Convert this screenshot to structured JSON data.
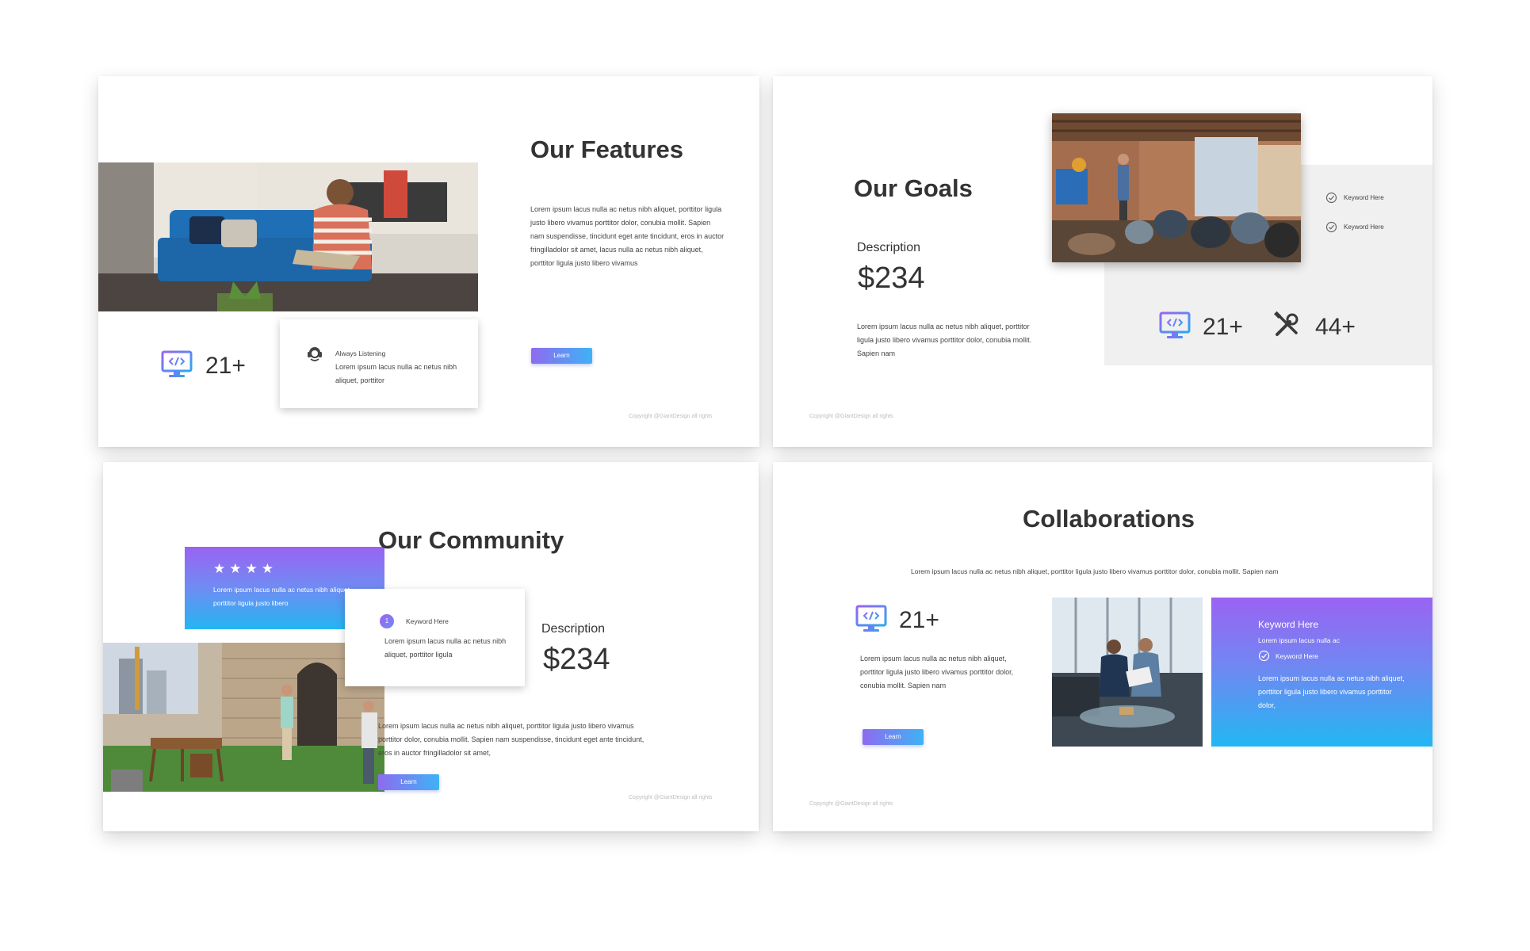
{
  "slide1": {
    "title": "Our Features",
    "body": "Lorem ipsum lacus nulla ac netus nibh aliquet, porttitor ligula justo libero vivamus porttitor dolor, conubia mollit. Sapien nam suspendisse, tincidunt eget ante tincidunt, eros in auctor fringilladolor sit amet, lacus nulla ac netus nibh aliquet, porttitor ligula justo libero vivamus",
    "stat": "21+",
    "card_title": "Always Listening",
    "card_body": "Lorem ipsum lacus nulla ac netus nibh aliquet, porttitor",
    "button": "Learn",
    "copyright": "Copyright @GiantDesign all rights"
  },
  "slide2": {
    "title": "Our Goals",
    "description_label": "Description",
    "price": "$234",
    "body": "Lorem ipsum lacus nulla ac netus nibh aliquet, porttitor ligula justo libero vivamus porttitor dolor, conubia mollit. Sapien nam",
    "keywords": [
      "Keyword Here",
      "Keyword Here"
    ],
    "stat1": "21+",
    "stat2": "44+",
    "copyright": "Copyright @GiantDesign all rights"
  },
  "slide3": {
    "title": "Our Community",
    "stars": "★★★★",
    "panel_text": "Lorem ipsum lacus nulla ac netus nibh aliquet, porttitor ligula justo libero",
    "card_number": "1",
    "card_title": "Keyword Here",
    "card_body": "Lorem ipsum lacus nulla ac netus nibh aliquet, porttitor ligula",
    "description_label": "Description",
    "price": "$234",
    "body": "Lorem ipsum lacus nulla ac netus nibh aliquet, porttitor ligula justo libero vivamus porttitor dolor, conubia mollit. Sapien nam suspendisse, tincidunt eget ante tincidunt, eros in auctor fringilladolor sit amet,",
    "button": "Learn",
    "copyright": "Copyright @GiantDesign all rights"
  },
  "slide4": {
    "title": "Collaborations",
    "subtitle": "Lorem ipsum lacus nulla ac netus nibh aliquet, porttitor ligula justo libero vivamus porttitor dolor, conubia mollit. Sapien nam",
    "stat": "21+",
    "body": "Lorem ipsum lacus nulla ac netus nibh aliquet, porttitor ligula justo libero vivamus porttitor dolor, conubia mollit. Sapien nam",
    "button": "Learn",
    "panel_title": "Keyword Here",
    "panel_sub": "Lorem ipsum lacus nulla ac",
    "panel_keyword": "Keyword Here",
    "panel_body": "Lorem ipsum lacus nulla ac netus nibh aliquet, porttitor ligula justo libero vivamus porttitor dolor,",
    "copyright": "Copyright @GiantDesign all rights"
  },
  "colors": {
    "gradient_start": "#9a63f2",
    "gradient_end": "#24b6f2",
    "grey_panel": "#f0f0f0"
  },
  "icons": [
    "monitor-code-icon",
    "headset-icon",
    "check-circle-icon",
    "tools-icon"
  ]
}
